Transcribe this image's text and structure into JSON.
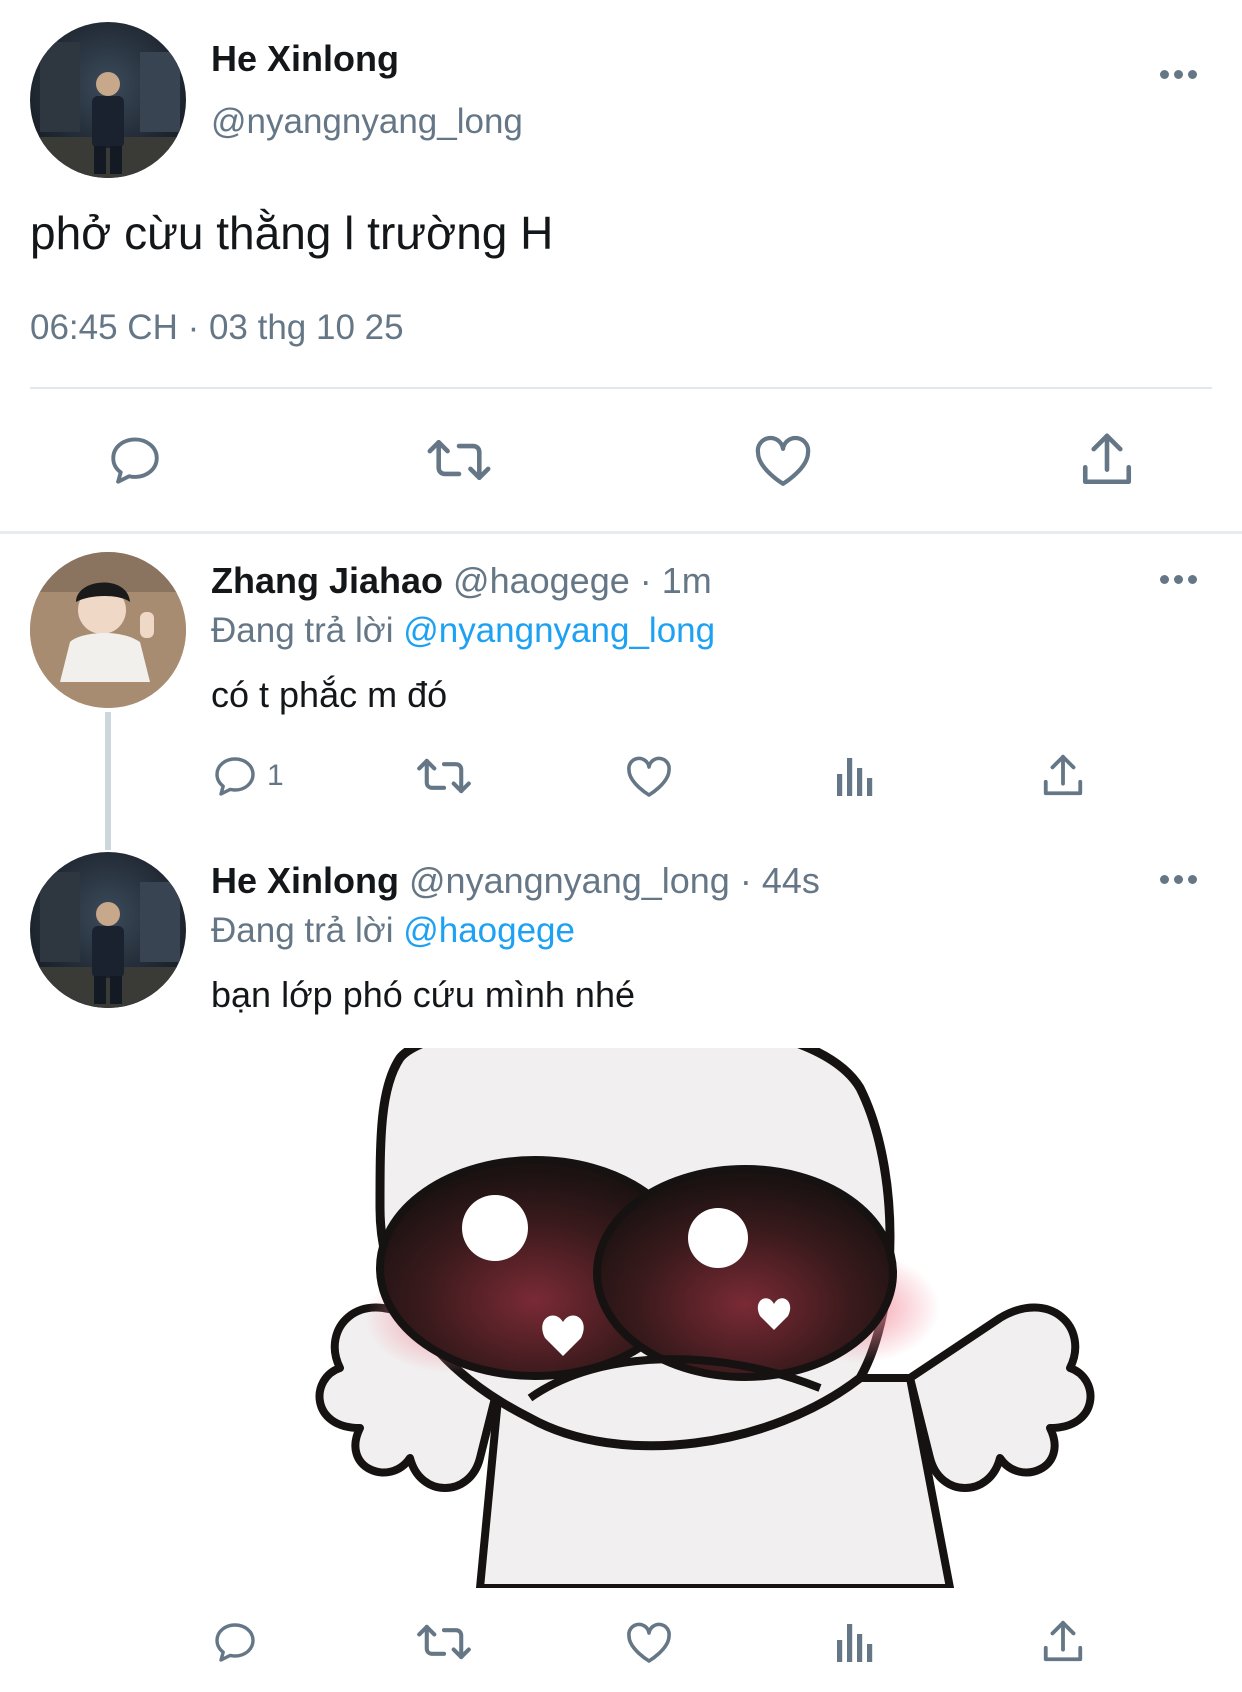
{
  "main_tweet": {
    "display_name": "He Xinlong",
    "handle": "@nyangnyang_long",
    "text": "phở cừu thằng l trường H",
    "timestamp": "06:45 CH · 03 thg 10 25",
    "actions": [
      "reply-icon",
      "retweet-icon",
      "like-icon",
      "share-icon"
    ]
  },
  "replies": [
    {
      "display_name": "Zhang Jiahao",
      "handle": "@haogege",
      "time": "· 1m",
      "replying_prefix": "Đang trả lời",
      "replying_to": "@nyangnyang_long",
      "text": "có t phắc m đó",
      "reply_count": "1"
    },
    {
      "display_name": "He Xinlong",
      "handle": "@nyangnyang_long",
      "time": "· 44s",
      "replying_prefix": "Đang trả lời",
      "replying_to": "@haogege",
      "text": "bạn lớp phó cứu mình nhé",
      "reply_count": ""
    }
  ],
  "colors": {
    "accent": "#1da1f2",
    "secondary_text": "#657786",
    "divider": "#e1e8ed"
  }
}
